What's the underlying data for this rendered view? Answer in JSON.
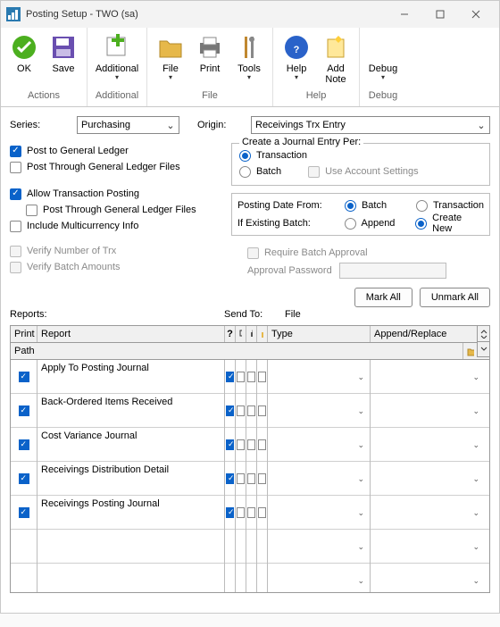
{
  "window": {
    "title": "Posting Setup  -  TWO (sa)"
  },
  "ribbon": {
    "ok": "OK",
    "save": "Save",
    "additional": "Additional",
    "file": "File",
    "print": "Print",
    "tools": "Tools",
    "help": "Help",
    "addnote": "Add\nNote",
    "debug": "Debug",
    "grp_actions": "Actions",
    "grp_additional": "Additional",
    "grp_file": "File",
    "grp_help": "Help",
    "grp_debug": "Debug"
  },
  "form": {
    "series_lbl": "Series:",
    "series_val": "Purchasing",
    "origin_lbl": "Origin:",
    "origin_val": "Receivings Trx Entry",
    "post_gl": "Post to General Ledger",
    "post_through": "Post Through General Ledger Files",
    "allow_trx": "Allow Transaction Posting",
    "post_through2": "Post Through General Ledger Files",
    "include_mc": "Include Multicurrency Info",
    "verify_num": "Verify Number of Trx",
    "verify_amt": "Verify Batch Amounts",
    "journal_legend": "Create a Journal Entry Per:",
    "r_transaction": "Transaction",
    "r_batch": "Batch",
    "use_acct": "Use Account Settings",
    "pdf_lbl": "Posting Date From:",
    "pdf_batch": "Batch",
    "pdf_trx": "Transaction",
    "ieb_lbl": "If Existing Batch:",
    "ieb_append": "Append",
    "ieb_create": "Create New",
    "req_appr": "Require Batch Approval",
    "appr_pw": "Approval Password",
    "mark_all": "Mark All",
    "unmark_all": "Unmark All",
    "reports_lbl": "Reports:",
    "sendto_lbl": "Send To:",
    "file_lbl": "File"
  },
  "grid": {
    "h_print": "Print",
    "h_report": "Report",
    "h_type": "Type",
    "h_ar": "Append/Replace",
    "h_path": "Path",
    "rows": [
      {
        "report": "Apply To Posting Journal"
      },
      {
        "report": "Back-Ordered Items Received"
      },
      {
        "report": "Cost Variance Journal"
      },
      {
        "report": "Receivings Distribution Detail"
      },
      {
        "report": "Receivings Posting Journal"
      }
    ]
  }
}
